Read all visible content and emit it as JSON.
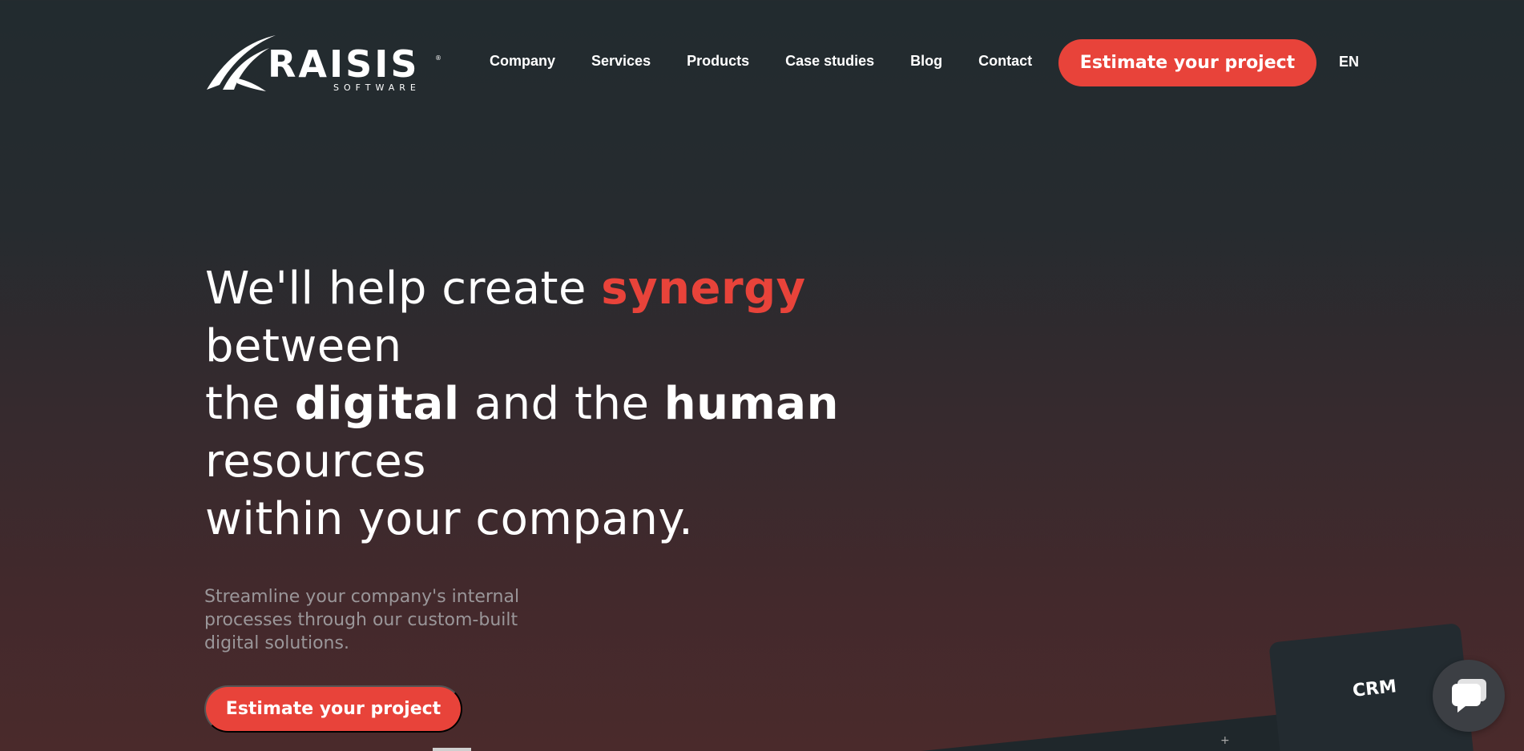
{
  "brand": {
    "name": "RAISIS",
    "sub": "SOFTWARE",
    "reg": "®"
  },
  "nav": {
    "items": [
      "Company",
      "Services",
      "Products",
      "Case studies",
      "Blog",
      "Contact"
    ],
    "cta": "Estimate your project",
    "lang": "EN"
  },
  "hero": {
    "line1_pre": "We'll help create ",
    "line1_accent": "synergy",
    "line2": "between",
    "line3_pre": "the ",
    "line3_bold1": "digital",
    "line3_mid": " and the ",
    "line3_bold2": "human",
    "line4": "resources",
    "line5": "within your company.",
    "subtitle": "Streamline your company's internal processes through our custom-built digital solutions.",
    "cta": "Estimate your project"
  },
  "illustration": {
    "crm_label": "CRM",
    "plus": "+"
  },
  "colors": {
    "accent": "#e8433a",
    "bg_top": "#222b2f",
    "bg_bottom": "#4a2a2b",
    "subtitle": "#9a9699"
  },
  "icons": {
    "chat": "chat-bubble-icon",
    "logo": "raisis-logo-icon"
  }
}
